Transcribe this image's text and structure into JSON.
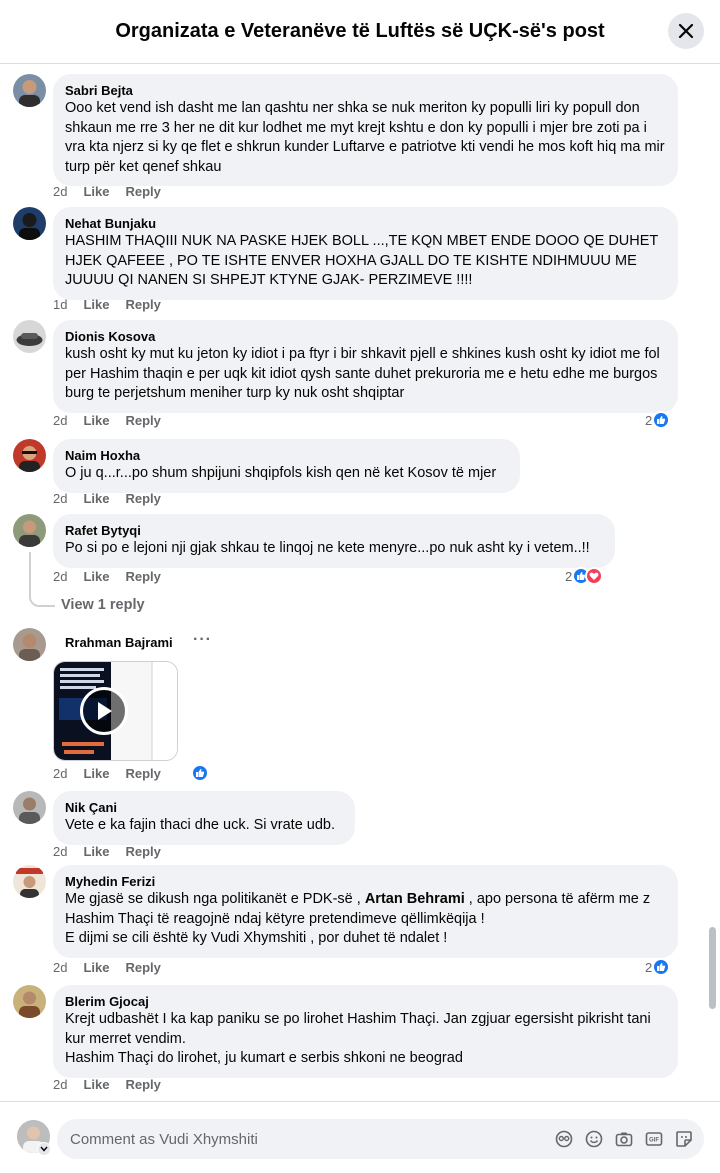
{
  "header": {
    "title": "Organizata e Veteranëve të Luftës së UÇK-së's post"
  },
  "comments": [
    {
      "author": "Sabri Bejta",
      "text": "Ooo ket vend ish dasht me lan qashtu ner shka se nuk meriton ky populli liri ky popull don shkaun me rre 3 her ne dit kur lodhet me myt krejt kshtu e don ky populli i mjer bre zoti pa i vra kta njerz si ky qe flet e shkrun kunder Luftarve e patriotve kti vendi he mos koft hiq ma mir turp për ket qenef shkau",
      "time": "2d",
      "like": "Like",
      "reply": "Reply"
    },
    {
      "author": "Nehat Bunjaku",
      "text": "HASHIM THAQIII NUK NA PASKE HJEK BOLL ...,TE KQN MBET ENDE DOOO QE DUHET HJEK QAFEEE , PO TE ISHTE ENVER HOXHA GJALL DO TE KISHTE NDIHMUUU ME JUUUU QI NANEN SI SHPEJT KTYNE GJAK- PERZIMEVE !!!!",
      "time": "1d",
      "like": "Like",
      "reply": "Reply"
    },
    {
      "author": "Dionis Kosova",
      "text": "kush osht ky mut ku jeton ky idiot i pa ftyr i bir shkavit pjell e shkines kush osht ky idiot me fol per Hashim thaqin e per uqk kit idiot qysh sante duhet prekuroria me e hetu edhe me burgos burg te perjetshum meniher turp ky nuk osht shqiptar",
      "time": "2d",
      "like": "Like",
      "reply": "Reply",
      "reactions": "2"
    },
    {
      "author": "Naim Hoxha",
      "text": "O ju q...r...po shum shpijuni shqipfols kish qen në ket Kosov të mjer",
      "time": "2d",
      "like": "Like",
      "reply": "Reply"
    },
    {
      "author": "Rafet Bytyqi",
      "text": "Po si po e lejoni nji gjak shkau te linqoj ne kete menyre...po nuk asht ky i vetem..!!",
      "time": "2d",
      "like": "Like",
      "reply": "Reply",
      "reactions": "2",
      "view_replies": "View 1 reply"
    },
    {
      "author": "Rrahman Bajrami",
      "more": "···",
      "time": "2d",
      "like": "Like",
      "reply": "Reply"
    },
    {
      "author": "Nik Çani",
      "text": "Vete e ka fajin thaci dhe uck. Si vrate udb.",
      "time": "2d",
      "like": "Like",
      "reply": "Reply"
    },
    {
      "author": "Myhedin Ferizi",
      "text_part1": "Me gjasë se dikush nga politikanët e PDK-së , ",
      "text_bold": "Artan Behrami",
      "text_part2": " , apo persona të afërm me z Hashim Thaçi të reagojnë ndaj këtyre pretendimeve qëllimkëqija !\nE dijmi se cili është ky Vudi Xhymshiti , por duhet të ndalet !",
      "time": "2d",
      "like": "Like",
      "reply": "Reply",
      "reactions": "2"
    },
    {
      "author": "Blerim Gjocaj",
      "text": "Krejt udbashët I ka kap paniku se po lirohet Hashim Thaçi. Jan zgjuar egersisht pikrisht tani kur merret vendim.\nHashim Thaçi do lirohet, ju kumart e serbis shkoni ne beograd",
      "time": "2d",
      "like": "Like",
      "reply": "Reply"
    }
  ],
  "footer": {
    "placeholder": "Comment as Vudi Xhymshiti"
  },
  "colors": {
    "accent": "#1877f2",
    "love": "#f33e58",
    "bubble": "#f0f2f5",
    "muted": "#65676b"
  }
}
